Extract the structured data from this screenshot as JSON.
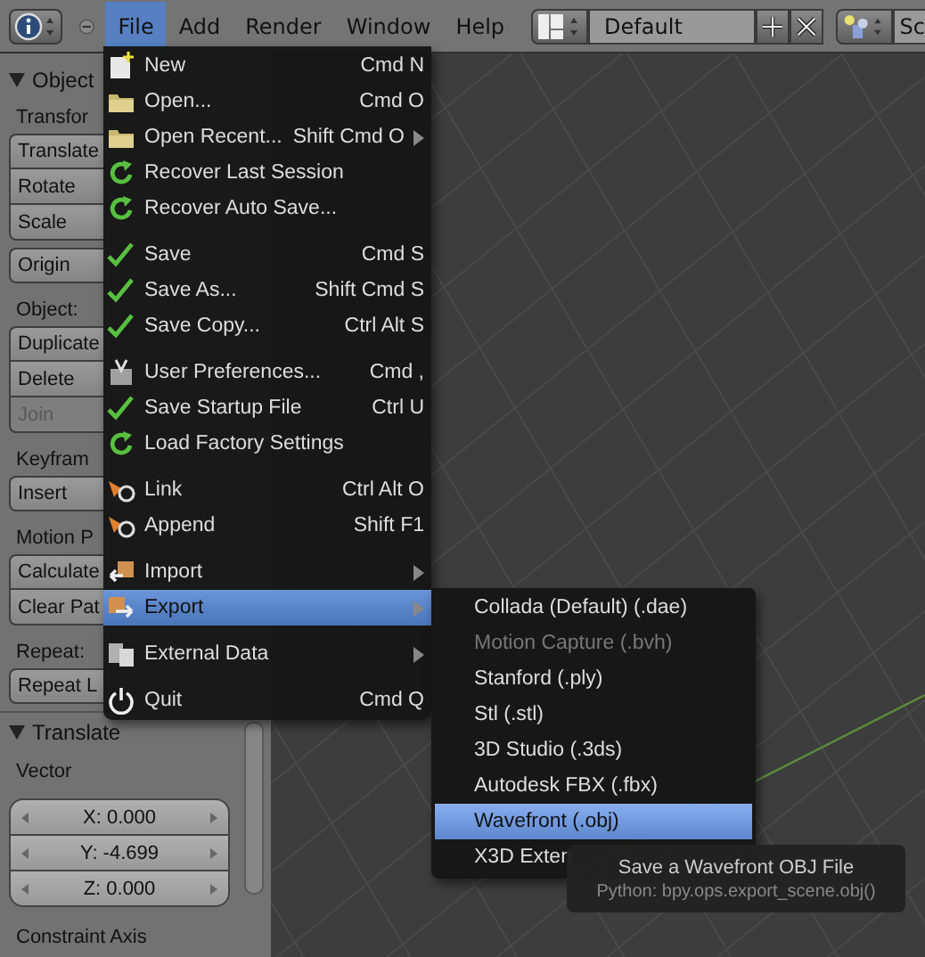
{
  "header": {
    "menus": [
      {
        "label": "File",
        "selected": true
      },
      {
        "label": "Add",
        "selected": false
      },
      {
        "label": "Render",
        "selected": false
      },
      {
        "label": "Window",
        "selected": false
      },
      {
        "label": "Help",
        "selected": false
      }
    ],
    "layout_field": {
      "value": "Default"
    },
    "scene_field": {
      "value": "Sc"
    }
  },
  "tool_panel": {
    "title": "Object",
    "sections": [
      {
        "label": "Transfor",
        "buttons": [
          {
            "label": "Translate",
            "disabled": false
          },
          {
            "label": "Rotate",
            "disabled": false
          },
          {
            "label": "Scale",
            "disabled": false
          }
        ]
      },
      {
        "buttons": [
          {
            "label": "Origin",
            "disabled": false
          }
        ]
      },
      {
        "label": "Object:",
        "buttons": [
          {
            "label": "Duplicate",
            "disabled": false
          },
          {
            "label": "Delete",
            "disabled": false
          },
          {
            "label": "Join",
            "disabled": true
          }
        ]
      },
      {
        "label": "Keyfram",
        "buttons": [
          {
            "label": "Insert",
            "disabled": false
          }
        ]
      },
      {
        "label": "Motion P",
        "buttons": [
          {
            "label": "Calculate",
            "disabled": false
          },
          {
            "label": "Clear Pat",
            "disabled": false
          }
        ]
      },
      {
        "label": "Repeat:",
        "buttons": [
          {
            "label": "Repeat L",
            "disabled": false
          }
        ]
      }
    ]
  },
  "operator_panel": {
    "title": "Translate",
    "vector_label": "Vector",
    "fields": [
      "X: 0.000",
      "Y: -4.699",
      "Z: 0.000"
    ],
    "constraint_label": "Constraint Axis"
  },
  "file_menu": {
    "items": [
      {
        "kind": "item",
        "label": "New",
        "shortcut": "Cmd N",
        "submenu": false,
        "selected": false
      },
      {
        "kind": "item",
        "label": "Open...",
        "shortcut": "Cmd O",
        "submenu": false,
        "selected": false
      },
      {
        "kind": "item",
        "label": "Open Recent...",
        "shortcut": "Shift Cmd O",
        "submenu": true,
        "selected": false
      },
      {
        "kind": "item",
        "label": "Recover Last Session",
        "submenu": false,
        "selected": false
      },
      {
        "kind": "item",
        "label": "Recover Auto Save...",
        "submenu": false,
        "selected": false
      },
      {
        "kind": "separator"
      },
      {
        "kind": "item",
        "label": "Save",
        "shortcut": "Cmd S",
        "submenu": false,
        "selected": false
      },
      {
        "kind": "item",
        "label": "Save As...",
        "shortcut": "Shift Cmd S",
        "submenu": false,
        "selected": false
      },
      {
        "kind": "item",
        "label": "Save Copy...",
        "shortcut": "Ctrl Alt S",
        "submenu": false,
        "selected": false
      },
      {
        "kind": "separator"
      },
      {
        "kind": "item",
        "label": "User Preferences...",
        "shortcut": "Cmd ,",
        "submenu": false,
        "selected": false
      },
      {
        "kind": "item",
        "label": "Save Startup File",
        "shortcut": "Ctrl U",
        "submenu": false,
        "selected": false
      },
      {
        "kind": "item",
        "label": "Load Factory Settings",
        "submenu": false,
        "selected": false
      },
      {
        "kind": "separator"
      },
      {
        "kind": "item",
        "label": "Link",
        "shortcut": "Ctrl Alt O",
        "submenu": false,
        "selected": false
      },
      {
        "kind": "item",
        "label": "Append",
        "shortcut": "Shift F1",
        "submenu": false,
        "selected": false
      },
      {
        "kind": "separator"
      },
      {
        "kind": "item",
        "label": "Import",
        "submenu": true,
        "selected": false
      },
      {
        "kind": "item",
        "label": "Export",
        "submenu": true,
        "selected": true
      },
      {
        "kind": "separator"
      },
      {
        "kind": "item",
        "label": "External Data",
        "submenu": true,
        "selected": false
      },
      {
        "kind": "separator"
      },
      {
        "kind": "item",
        "label": "Quit",
        "shortcut": "Cmd Q",
        "submenu": false,
        "selected": false
      }
    ]
  },
  "export_menu": {
    "items": [
      {
        "label": "Collada (Default) (.dae)",
        "disabled": false,
        "selected": false
      },
      {
        "label": "Motion Capture (.bvh)",
        "disabled": true,
        "selected": false
      },
      {
        "label": "Stanford (.ply)",
        "disabled": false,
        "selected": false
      },
      {
        "label": "Stl (.stl)",
        "disabled": false,
        "selected": false
      },
      {
        "label": "3D Studio (.3ds)",
        "disabled": false,
        "selected": false
      },
      {
        "label": "Autodesk FBX (.fbx)",
        "disabled": false,
        "selected": false
      },
      {
        "label": "Wavefront (.obj)",
        "disabled": false,
        "selected": true
      },
      {
        "label": "X3D Exten",
        "disabled": false,
        "selected": false
      }
    ]
  },
  "tooltip": {
    "title": "Save a Wavefront OBJ File",
    "python": "Python: bpy.ops.export_scene.obj()"
  }
}
